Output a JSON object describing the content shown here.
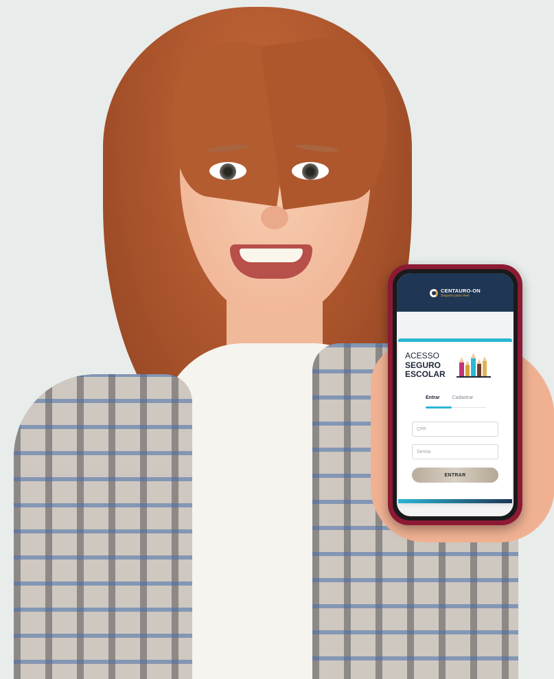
{
  "brand": {
    "name": "CENTAURO-ON",
    "tagline": "Seguros para viver"
  },
  "card": {
    "title_line1": "ACESSO",
    "title_line2": "SEGURO",
    "title_line3": "ESCOLAR",
    "illustration": "pencils-icon"
  },
  "tabs": [
    {
      "label": "Entrar",
      "active": true
    },
    {
      "label": "Cadastrar",
      "active": false
    }
  ],
  "form": {
    "cpf_placeholder": "CPF",
    "cpf_value": "",
    "password_placeholder": "Senha",
    "password_value": "",
    "submit_label": "ENTRAR"
  },
  "colors": {
    "header_bg": "#1f3654",
    "accent": "#2bb6d4",
    "gold": "#d8a24c",
    "phone_case": "#8c1a34",
    "button": "#c9bfb1"
  }
}
